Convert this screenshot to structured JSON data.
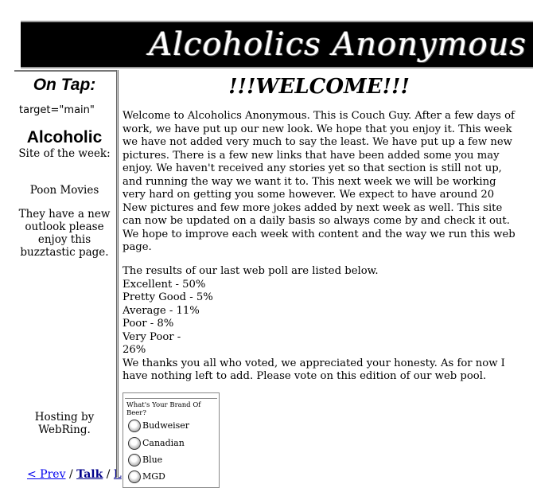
{
  "banner": {
    "title": "Alcoholics Anonymous"
  },
  "nav": {
    "title": "On Tap:",
    "target_text": "target=\"main\"",
    "site_of_week": {
      "heading": "Alcoholic",
      "subheading": "Site of the week:",
      "site_name": "Poon Movies",
      "description": "They have a new outlook please enjoy this buzztastic page."
    },
    "hosting_text": "Hosting by WebRing.",
    "webring": {
      "prev_label": "< Prev",
      "separator": " / ",
      "talk_label": "Talk",
      "next_label_partial": "L"
    }
  },
  "main": {
    "heading": "!!!WELCOME!!!",
    "intro": "Welcome to Alcoholics Anonymous. This is Couch Guy. After a few days of work, we have put up our new look. We hope that you enjoy it. This week we have not added very much to say the least. We have put up a few new pictures. There is a few new links that have been added some you may enjoy. We haven't received any stories yet so that section is still not up, and running the way we want it to. This next week we will be working very hard on getting you some however. We expect to have around 20 New pictures and few more jokes added by next week as well. This site can now be updated on a daily basis so always come by and check it out. We hope to improve each week with content and the way we run this web page.",
    "poll_intro": "The results of our last web poll are listed below.",
    "poll_results": [
      "Excellent - 50%",
      "Pretty Good - 5%",
      "Average - 11%",
      "Poor - 8%",
      "Very Poor -",
      "26%"
    ],
    "closing": "We thanks you all who voted, we appreciated your honesty. As for now I have nothing left to add. Please vote on this edition of our web pool."
  },
  "poll": {
    "question": "What's Your Brand Of Beer?",
    "options": [
      "Budweiser",
      "Canadian",
      "Blue",
      "MGD"
    ]
  }
}
